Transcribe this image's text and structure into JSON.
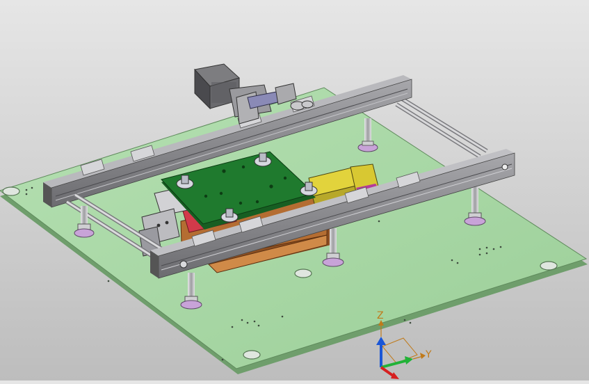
{
  "viewport": {
    "background_top": "#e6e6e6",
    "background_bottom": "#bdbdbd"
  },
  "colors": {
    "base_plate": "#a9d8a6",
    "base_plate_edge": "#6f9e6c",
    "rail": "#8c8c90",
    "rail_dark": "#5d5d62",
    "pcb": "#1f7a2e",
    "actuator": "#e2d33c",
    "wood": "#a8662b",
    "foot_pad": "#c8a3d8",
    "accent_red": "#d23a4a",
    "axis_z": "#1a56d6",
    "axis_y": "#21b238",
    "axis_x": "#d62020"
  },
  "triad": {
    "z_label": "Z",
    "y_label": "Y"
  },
  "icons": {
    "stepper_motor": "motor-icon",
    "triad": "axis-triad-icon"
  }
}
